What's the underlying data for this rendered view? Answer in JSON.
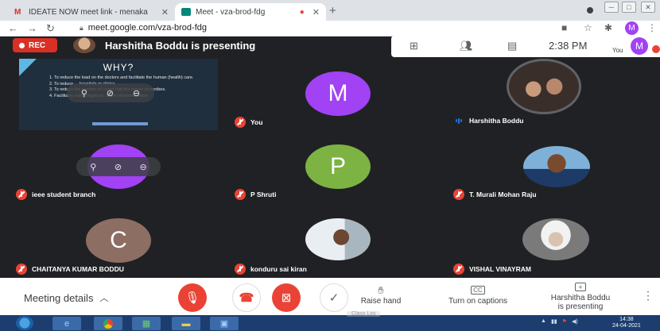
{
  "browser": {
    "tabs": [
      {
        "label": "IDEATE NOW meet link - menaka"
      },
      {
        "label": "Meet - vza-brod-fdg"
      }
    ],
    "url": "meet.google.com/vza-brod-fdg",
    "profile_initial": "M"
  },
  "meet": {
    "rec_label": "REC",
    "presenting_text": "Harshitha Boddu is presenting",
    "time": "2:38 PM",
    "you_label": "You",
    "you_initial": "M",
    "slide": {
      "title": "WHY?",
      "items": [
        "1.  To reduce the load on the doctors and facilitate the human (health) care.",
        "2.  To reduce ... hospitals or clinics.",
        "3.  To reduce the number of cases that the doctor prescribes.",
        "4.  Facilitates early diagnosis of the ailment/disease."
      ]
    },
    "participants": [
      {
        "name": "You",
        "initial": "M",
        "color": "#a142f4"
      },
      {
        "name": "Harshitha Boddu"
      },
      {
        "name": "ieee student branch"
      },
      {
        "name": "P Shruti",
        "initial": "P",
        "color": "#7cb342"
      },
      {
        "name": "T. Murali Mohan Raju"
      },
      {
        "name": "CHAITANYA KUMAR BODDU",
        "initial": "C",
        "color": "#8d6e63"
      },
      {
        "name": "konduru sai kiran"
      },
      {
        "name": "VISHAL VINAYRAM"
      }
    ]
  },
  "bottom": {
    "meeting_details": "Meeting details",
    "raise_hand": "Raise hand",
    "captions": "Turn on captions",
    "present_line1": "Harshitha Boddu",
    "present_line2": "is presenting"
  },
  "taskbar": {
    "class_list": "Class List",
    "clock_time": "14:38",
    "clock_date": "24-04-2021"
  },
  "colors": {
    "rec": "#d93025",
    "mic_off": "#ea4335",
    "meet_bg": "#202124"
  }
}
